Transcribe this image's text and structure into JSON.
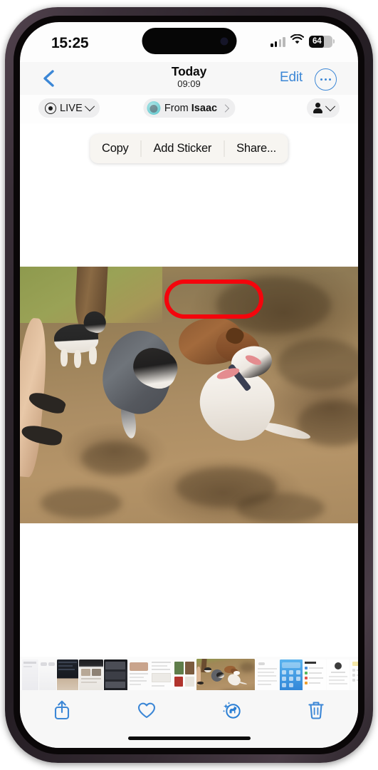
{
  "status_bar": {
    "time": "15:25",
    "cellular_icon": "cellular-bars-icon",
    "cellular_bars_filled": 2,
    "cellular_bars_total": 4,
    "wifi_icon": "wifi-icon",
    "battery_icon": "battery-icon",
    "battery_percent": "64"
  },
  "nav_bar": {
    "back_icon": "back-chevron-icon",
    "title": "Today",
    "subtitle": "09:09",
    "edit_label": "Edit",
    "more_icon": "ellipsis-circle-icon"
  },
  "pill_bar": {
    "live": {
      "icon": "live-photo-icon",
      "label": "LIVE",
      "chevron_icon": "chevron-down-icon"
    },
    "from": {
      "avatar_icon": "contact-avatar",
      "prefix": "From ",
      "name": "Isaac",
      "chevron_icon": "chevron-right-icon"
    },
    "people": {
      "icon": "person-icon",
      "chevron_icon": "chevron-down-icon"
    }
  },
  "context_menu": {
    "items": [
      {
        "label": "Copy",
        "name": "copy-menu-item",
        "highlighted": false
      },
      {
        "label": "Add Sticker",
        "name": "add-sticker-menu-item",
        "highlighted": true
      },
      {
        "label": "Share...",
        "name": "share-menu-item",
        "highlighted": false
      }
    ],
    "highlight_color": "#f4050c"
  },
  "photo": {
    "description": "Four dogs playing in a dirt dog park under tree shadows; a person's legs in sandals at left"
  },
  "filmstrip": {
    "selected_index": 7,
    "thumbnails": [
      {
        "name": "thumbnail-0",
        "kind": "screenshot-light"
      },
      {
        "name": "thumbnail-1",
        "kind": "screenshot-light"
      },
      {
        "name": "thumbnail-2",
        "kind": "screenshot-dark"
      },
      {
        "name": "thumbnail-3",
        "kind": "screenshot-article"
      },
      {
        "name": "thumbnail-4",
        "kind": "screenshot-dark"
      },
      {
        "name": "thumbnail-5",
        "kind": "screenshot-article"
      },
      {
        "name": "thumbnail-6",
        "kind": "screenshot-article"
      },
      {
        "name": "thumbnail-7",
        "kind": "photo-dogs"
      },
      {
        "name": "thumbnail-8",
        "kind": "screenshot-text"
      },
      {
        "name": "thumbnail-9",
        "kind": "screenshot-blue-app"
      },
      {
        "name": "thumbnail-10",
        "kind": "screenshot-settings"
      },
      {
        "name": "thumbnail-11",
        "kind": "screenshot-profile"
      },
      {
        "name": "thumbnail-12",
        "kind": "screenshot-list"
      },
      {
        "name": "thumbnail-13",
        "kind": "screenshot-profile"
      },
      {
        "name": "thumbnail-14",
        "kind": "screenshot-profile"
      },
      {
        "name": "thumbnail-15",
        "kind": "screenshot-profile"
      }
    ]
  },
  "bottom_bar": {
    "buttons": [
      {
        "name": "share-button",
        "icon": "share-icon"
      },
      {
        "name": "favorite-button",
        "icon": "heart-icon"
      },
      {
        "name": "visual-lookup-button",
        "icon": "visual-lookup-dog-icon"
      },
      {
        "name": "delete-button",
        "icon": "trash-icon"
      }
    ],
    "tint_color": "#3c87d6"
  }
}
